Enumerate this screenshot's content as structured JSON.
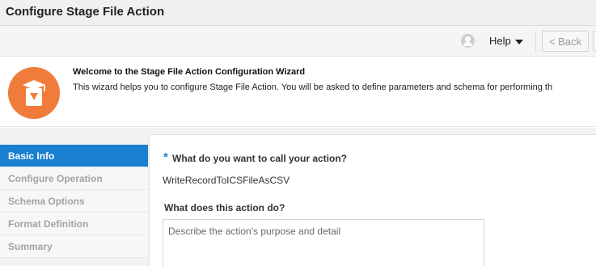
{
  "window": {
    "title": "Configure Stage File Action"
  },
  "toolbar": {
    "help_label": "Help",
    "back_label": "< Back"
  },
  "welcome": {
    "title": "Welcome to the Stage File Action Configuration Wizard",
    "description": "This wizard helps you to configure Stage File Action. You will be asked to define parameters and schema for performing th"
  },
  "steps": [
    {
      "label": "Basic Info",
      "active": true
    },
    {
      "label": "Configure Operation",
      "active": false
    },
    {
      "label": "Schema Options",
      "active": false
    },
    {
      "label": "Format Definition",
      "active": false
    },
    {
      "label": "Summary",
      "active": false
    }
  ],
  "form": {
    "required_marker": "*",
    "name_question": "What do you want to call your action?",
    "name_value": "WriteRecordToICSFileAsCSV",
    "description_question": "What does this action do?",
    "description_placeholder": "Describe the action's purpose and detail"
  },
  "colors": {
    "accent": "#1a7fcf",
    "wizard_icon": "#f07c3b"
  }
}
